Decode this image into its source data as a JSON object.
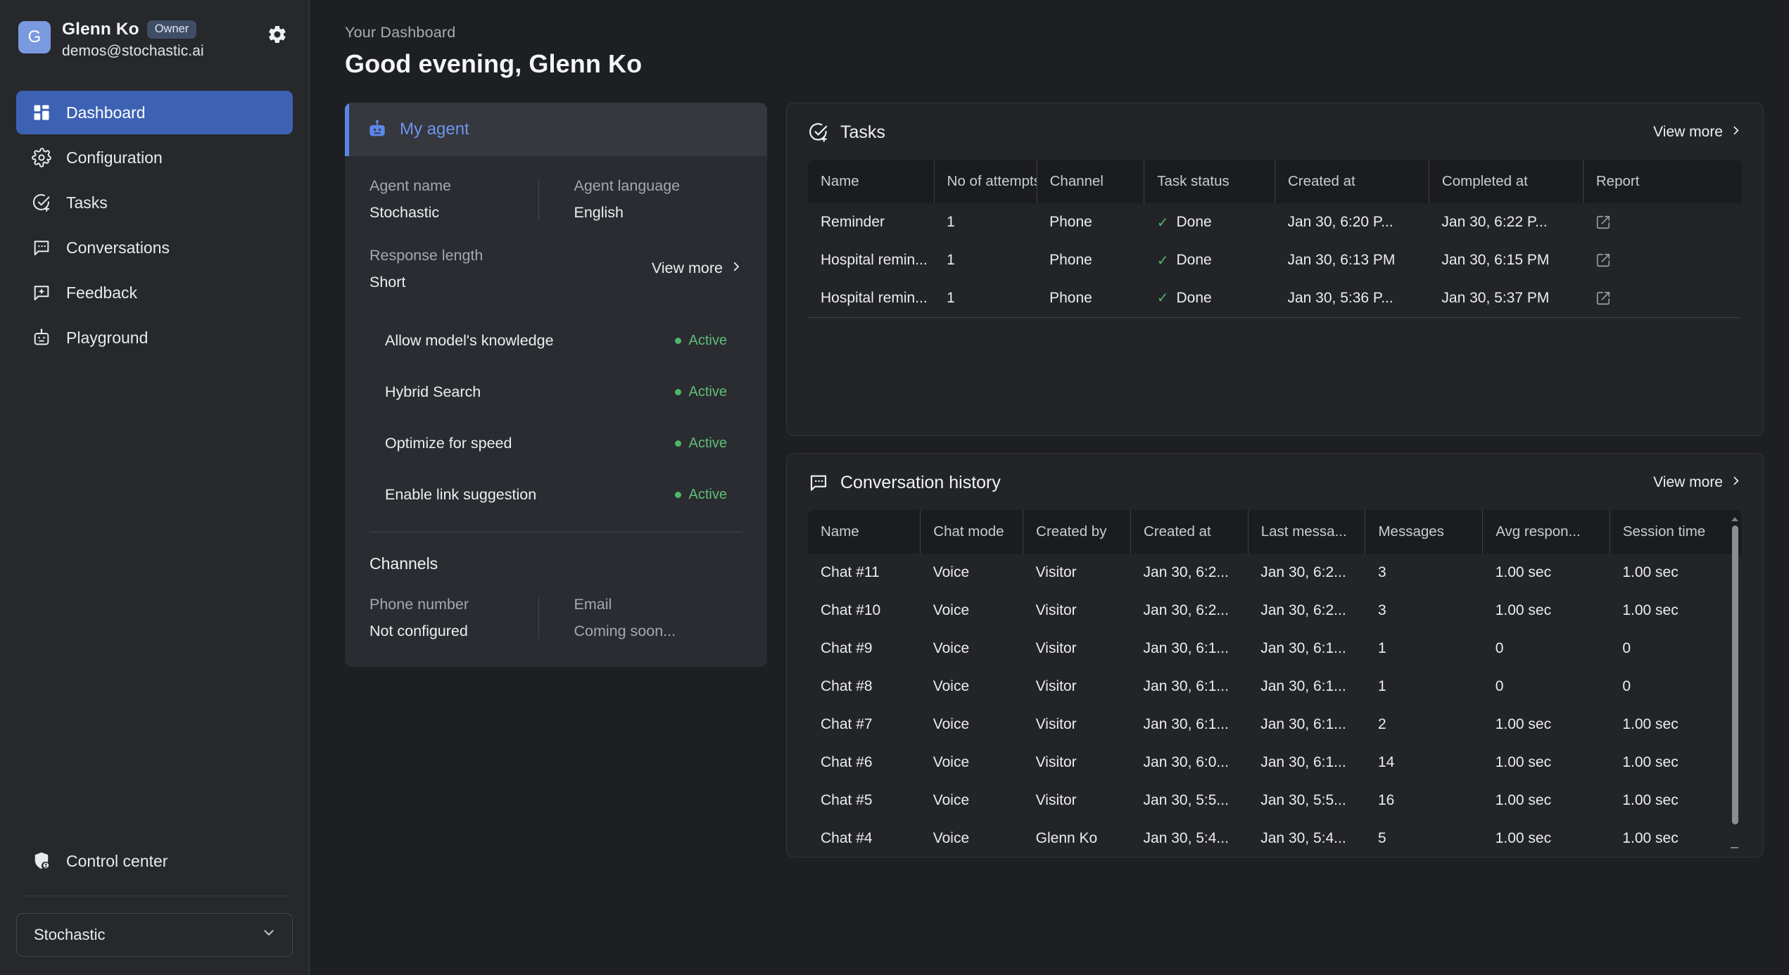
{
  "sidebar": {
    "user": {
      "initial": "G",
      "name": "Glenn Ko",
      "role_badge": "Owner",
      "email": "demos@stochastic.ai"
    },
    "nav_items": [
      {
        "label": "Dashboard",
        "icon": "dashboard-icon",
        "active": true
      },
      {
        "label": "Configuration",
        "icon": "gear-icon",
        "active": false
      },
      {
        "label": "Tasks",
        "icon": "task-check-icon",
        "active": false
      },
      {
        "label": "Conversations",
        "icon": "chat-bubble-icon",
        "active": false
      },
      {
        "label": "Feedback",
        "icon": "feedback-sparkle-icon",
        "active": false
      },
      {
        "label": "Playground",
        "icon": "robot-icon",
        "active": false
      }
    ],
    "control_center": {
      "label": "Control center",
      "icon": "shield-user-icon"
    },
    "org_select": {
      "value": "Stochastic",
      "icon": "chevron-down-icon"
    }
  },
  "header": {
    "eyebrow": "Your Dashboard",
    "title": "Good evening, Glenn Ko"
  },
  "agent_card": {
    "title": "My agent",
    "icon": "robot-icon",
    "fields": {
      "agent_name_label": "Agent name",
      "agent_name_value": "Stochastic",
      "agent_language_label": "Agent language",
      "agent_language_value": "English",
      "response_length_label": "Response length",
      "response_length_value": "Short"
    },
    "view_more": "View more",
    "features": [
      {
        "label": "Allow model's knowledge",
        "status": "Active"
      },
      {
        "label": "Hybrid Search",
        "status": "Active"
      },
      {
        "label": "Optimize for speed",
        "status": "Active"
      },
      {
        "label": "Enable link suggestion",
        "status": "Active"
      }
    ],
    "channels": {
      "title": "Channels",
      "phone_label": "Phone number",
      "phone_value": "Not configured",
      "email_label": "Email",
      "email_value": "Coming soon..."
    }
  },
  "tasks_panel": {
    "title": "Tasks",
    "icon": "task-check-icon",
    "view_more": "View more",
    "columns": [
      "Name",
      "No of attempts",
      "Channel",
      "Task status",
      "Created at",
      "Completed at",
      "Report"
    ],
    "rows": [
      {
        "name": "Reminder",
        "attempts": "1",
        "channel": "Phone",
        "status": "Done",
        "created_at": "Jan 30, 6:20 P...",
        "completed_at": "Jan 30, 6:22 P...",
        "report": "external-link-icon"
      },
      {
        "name": "Hospital remin...",
        "attempts": "1",
        "channel": "Phone",
        "status": "Done",
        "created_at": "Jan 30, 6:13 PM",
        "completed_at": "Jan 30, 6:15 PM",
        "report": "external-link-icon"
      },
      {
        "name": "Hospital remin...",
        "attempts": "1",
        "channel": "Phone",
        "status": "Done",
        "created_at": "Jan 30, 5:36 P...",
        "completed_at": "Jan 30, 5:37 PM",
        "report": "external-link-icon"
      }
    ]
  },
  "conversation_panel": {
    "title": "Conversation history",
    "icon": "chat-bubble-icon",
    "view_more": "View more",
    "columns": [
      "Name",
      "Chat mode",
      "Created by",
      "Created at",
      "Last messa...",
      "Messages",
      "Avg respon...",
      "Session time"
    ],
    "rows": [
      {
        "name": "Chat #11",
        "mode": "Voice",
        "created_by": "Visitor",
        "created_at": "Jan 30, 6:2...",
        "last_message": "Jan 30, 6:2...",
        "messages": "3",
        "avg_response": "1.00 sec",
        "session_time": "1.00 sec"
      },
      {
        "name": "Chat #10",
        "mode": "Voice",
        "created_by": "Visitor",
        "created_at": "Jan 30, 6:2...",
        "last_message": "Jan 30, 6:2...",
        "messages": "3",
        "avg_response": "1.00 sec",
        "session_time": "1.00 sec"
      },
      {
        "name": "Chat #9",
        "mode": "Voice",
        "created_by": "Visitor",
        "created_at": "Jan 30, 6:1...",
        "last_message": "Jan 30, 6:1...",
        "messages": "1",
        "avg_response": "0",
        "session_time": "0"
      },
      {
        "name": "Chat #8",
        "mode": "Voice",
        "created_by": "Visitor",
        "created_at": "Jan 30, 6:1...",
        "last_message": "Jan 30, 6:1...",
        "messages": "1",
        "avg_response": "0",
        "session_time": "0"
      },
      {
        "name": "Chat #7",
        "mode": "Voice",
        "created_by": "Visitor",
        "created_at": "Jan 30, 6:1...",
        "last_message": "Jan 30, 6:1...",
        "messages": "2",
        "avg_response": "1.00 sec",
        "session_time": "1.00 sec"
      },
      {
        "name": "Chat #6",
        "mode": "Voice",
        "created_by": "Visitor",
        "created_at": "Jan 30, 6:0...",
        "last_message": "Jan 30, 6:1...",
        "messages": "14",
        "avg_response": "1.00 sec",
        "session_time": "1.00 sec"
      },
      {
        "name": "Chat #5",
        "mode": "Voice",
        "created_by": "Visitor",
        "created_at": "Jan 30, 5:5...",
        "last_message": "Jan 30, 5:5...",
        "messages": "16",
        "avg_response": "1.00 sec",
        "session_time": "1.00 sec"
      },
      {
        "name": "Chat #4",
        "mode": "Voice",
        "created_by": "Glenn Ko",
        "created_at": "Jan 30, 5:4...",
        "last_message": "Jan 30, 5:4...",
        "messages": "5",
        "avg_response": "1.00 sec",
        "session_time": "1.00 sec"
      }
    ]
  },
  "colors": {
    "accent_blue": "#3d62b4",
    "agent_accent": "#5b86e8",
    "status_green": "#4eb86a",
    "panel_bg": "#232428",
    "sidebar_bg": "#26282c",
    "page_bg": "#1e1f22"
  }
}
